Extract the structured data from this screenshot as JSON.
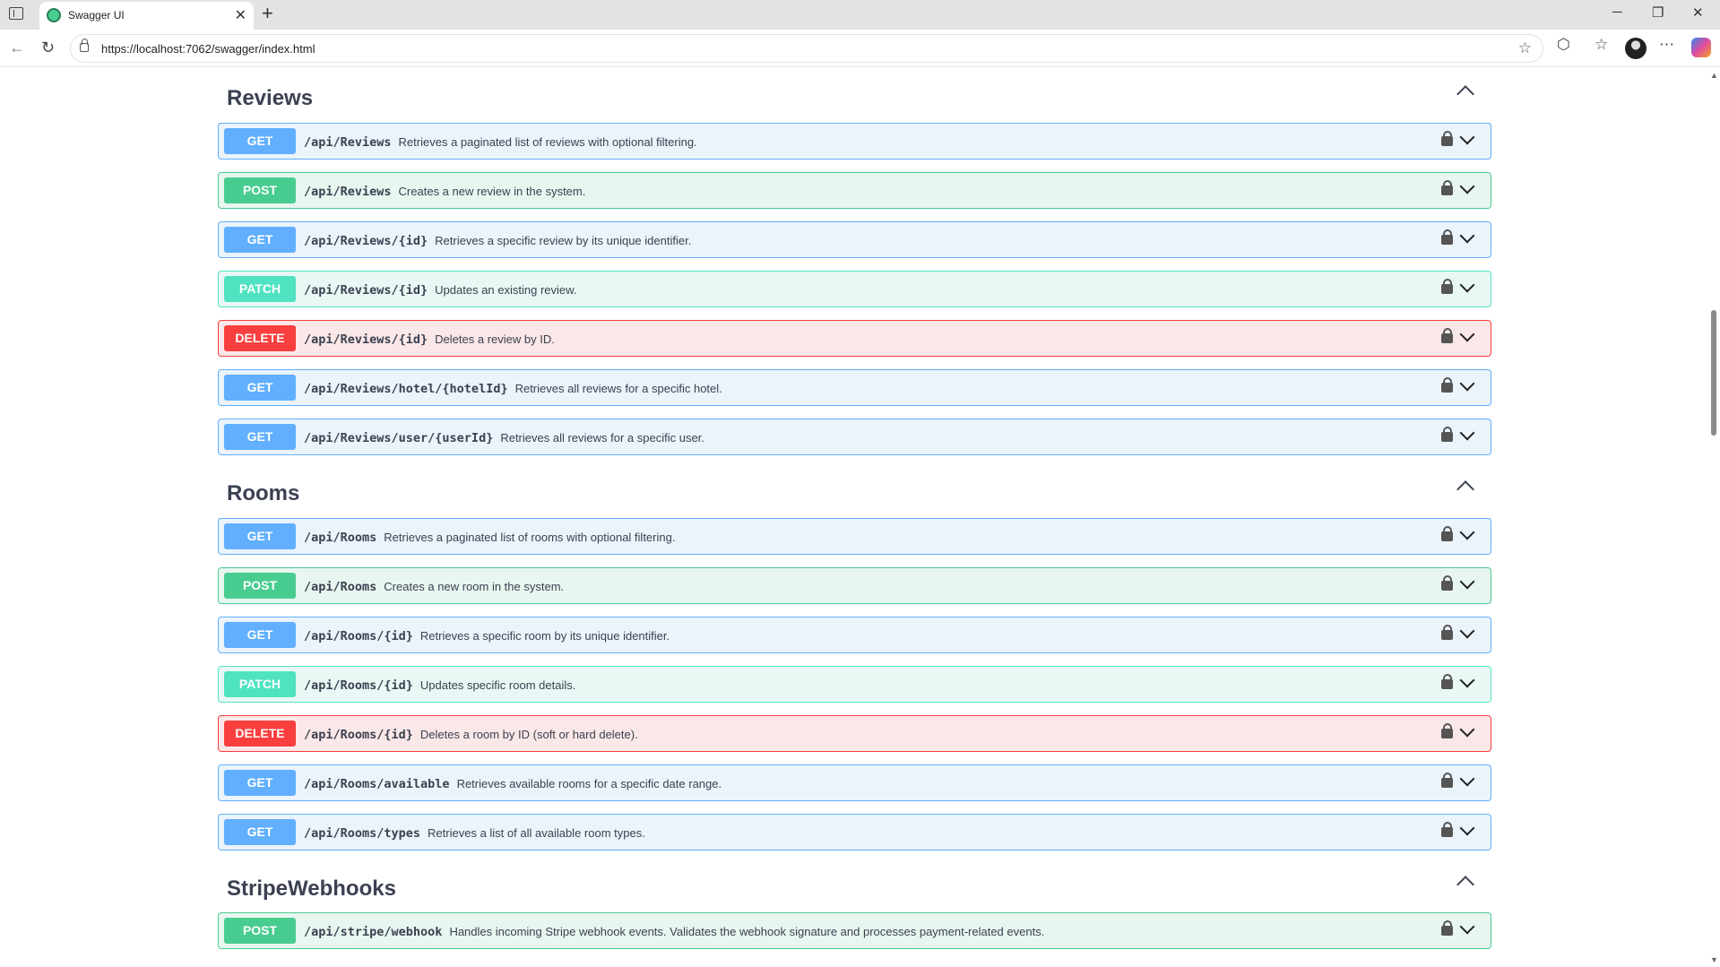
{
  "browser": {
    "tab_title": "Swagger UI",
    "url": "https://localhost:7062/swagger/index.html"
  },
  "sections": [
    {
      "title": "Reviews",
      "operations": [
        {
          "method": "GET",
          "path": "/api/Reviews",
          "summary": "Retrieves a paginated list of reviews with optional filtering."
        },
        {
          "method": "POST",
          "path": "/api/Reviews",
          "summary": "Creates a new review in the system."
        },
        {
          "method": "GET",
          "path": "/api/Reviews/{id}",
          "summary": "Retrieves a specific review by its unique identifier."
        },
        {
          "method": "PATCH",
          "path": "/api/Reviews/{id}",
          "summary": "Updates an existing review."
        },
        {
          "method": "DELETE",
          "path": "/api/Reviews/{id}",
          "summary": "Deletes a review by ID."
        },
        {
          "method": "GET",
          "path": "/api/Reviews/hotel/{hotelId}",
          "summary": "Retrieves all reviews for a specific hotel."
        },
        {
          "method": "GET",
          "path": "/api/Reviews/user/{userId}",
          "summary": "Retrieves all reviews for a specific user."
        }
      ]
    },
    {
      "title": "Rooms",
      "operations": [
        {
          "method": "GET",
          "path": "/api/Rooms",
          "summary": "Retrieves a paginated list of rooms with optional filtering."
        },
        {
          "method": "POST",
          "path": "/api/Rooms",
          "summary": "Creates a new room in the system."
        },
        {
          "method": "GET",
          "path": "/api/Rooms/{id}",
          "summary": "Retrieves a specific room by its unique identifier."
        },
        {
          "method": "PATCH",
          "path": "/api/Rooms/{id}",
          "summary": "Updates specific room details."
        },
        {
          "method": "DELETE",
          "path": "/api/Rooms/{id}",
          "summary": "Deletes a room by ID (soft or hard delete)."
        },
        {
          "method": "GET",
          "path": "/api/Rooms/available",
          "summary": "Retrieves available rooms for a specific date range."
        },
        {
          "method": "GET",
          "path": "/api/Rooms/types",
          "summary": "Retrieves a list of all available room types."
        }
      ]
    },
    {
      "title": "StripeWebhooks",
      "operations": [
        {
          "method": "POST",
          "path": "/api/stripe/webhook",
          "summary": "Handles incoming Stripe webhook events. Validates the webhook signature and processes payment-related events."
        }
      ]
    }
  ],
  "colors": {
    "get": "#61affe",
    "post": "#49cc90",
    "patch": "#50e3c2",
    "delete": "#f93e3e"
  }
}
